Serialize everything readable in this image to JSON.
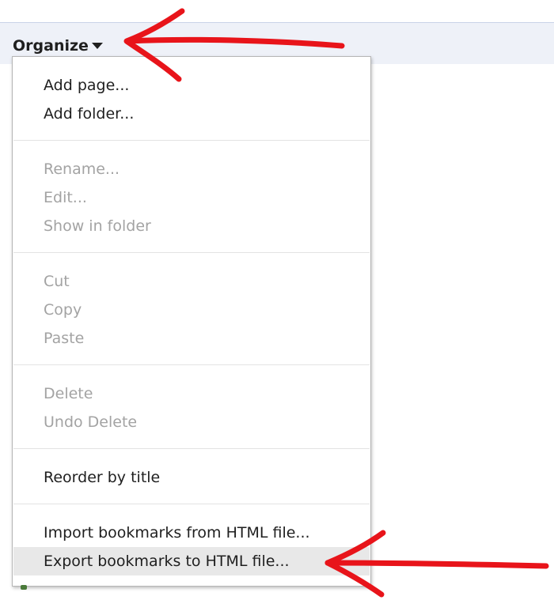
{
  "toolbar": {
    "organize_label": "Organize"
  },
  "menu": {
    "add_page": "Add page...",
    "add_folder": "Add folder...",
    "rename": "Rename...",
    "edit": "Edit...",
    "show_in_folder": "Show in folder",
    "cut": "Cut",
    "copy": "Copy",
    "paste": "Paste",
    "delete": "Delete",
    "undo_delete": "Undo Delete",
    "reorder_by_title": "Reorder by title",
    "import_bookmarks": "Import bookmarks from HTML file...",
    "export_bookmarks": "Export bookmarks to HTML file..."
  },
  "colors": {
    "annotation_red": "#e8141a",
    "toolbar_bg": "#eef1f8",
    "disabled_text": "#a3a3a3",
    "hover_bg": "#e8e8e8"
  },
  "icons": {
    "organize_caret": "chevron-down-icon",
    "annotation": "red-arrow-icon"
  }
}
